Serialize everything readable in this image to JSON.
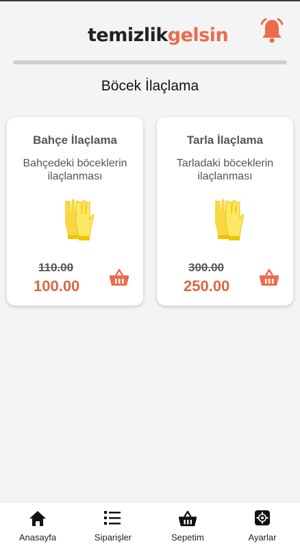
{
  "header": {
    "logo_part1": "temizlik",
    "logo_part2": "gelsin"
  },
  "page_title": "Böcek İlaçlama",
  "products": [
    {
      "title": "Bahçe İlaçlama",
      "description": "Bahçedeki böceklerin ilaçlanması",
      "old_price": "110.00",
      "price": "100.00",
      "image_icon": "gloves-icon"
    },
    {
      "title": "Tarla İlaçlama",
      "description": "Tarladaki böceklerin ilaçlanması",
      "old_price": "300.00",
      "price": "250.00",
      "image_icon": "gloves-icon"
    }
  ],
  "nav": [
    {
      "label": "Anasayfa",
      "icon": "home-icon"
    },
    {
      "label": "Siparişler",
      "icon": "list-icon"
    },
    {
      "label": "Sepetim",
      "icon": "basket-icon"
    },
    {
      "label": "Ayarlar",
      "icon": "gear-icon"
    }
  ],
  "colors": {
    "accent": "#ec6b4e",
    "price": "#d9673f",
    "glove": "#f5dc38"
  }
}
